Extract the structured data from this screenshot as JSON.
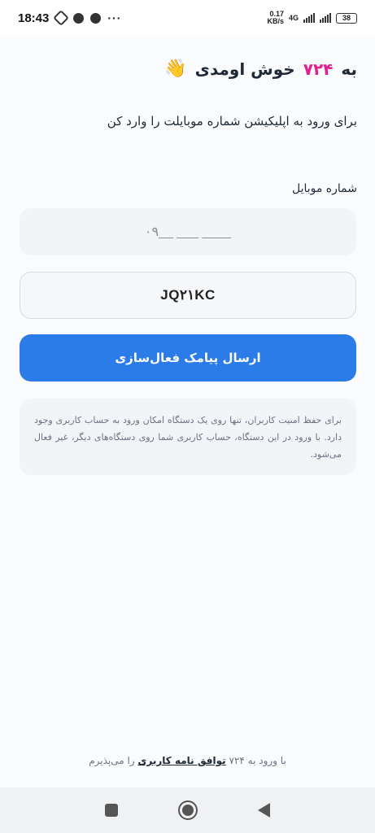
{
  "status_bar": {
    "time": "18:43",
    "more": "···",
    "net_speed_value": "0.17",
    "net_speed_unit": "KB/s",
    "network": "4G",
    "battery": "38"
  },
  "welcome": {
    "prefix": "به",
    "brand": "۷۲۴",
    "suffix": "خوش اومدی",
    "emoji": "👋"
  },
  "subtitle": "برای ورود به اپلیکیشن شماره موبایلت را وارد کن",
  "phone_field": {
    "label": "شماره موبایل",
    "placeholder": "۰۹__ ___ ____"
  },
  "invite_field": {
    "value": "JQ۲۱KC"
  },
  "primary_button": "ارسال پیامک فعال‌سازی",
  "notice": "برای حفظ امنیت کاربران، تنها روی یک دستگاه امکان ورود به حساب کاربری وجود دارد. با ورود در این دستگاه، حساب کاربری شما روی دستگاه‌های دیگر، غیر فعال می‌شود.",
  "terms": {
    "before": "با ورود به ۷۲۴",
    "link": "توافق نامه کاربری",
    "after": "را می‌پذیرم"
  },
  "nav": {
    "recent": "square-icon",
    "home": "circle-icon",
    "back": "triangle-back-icon"
  }
}
